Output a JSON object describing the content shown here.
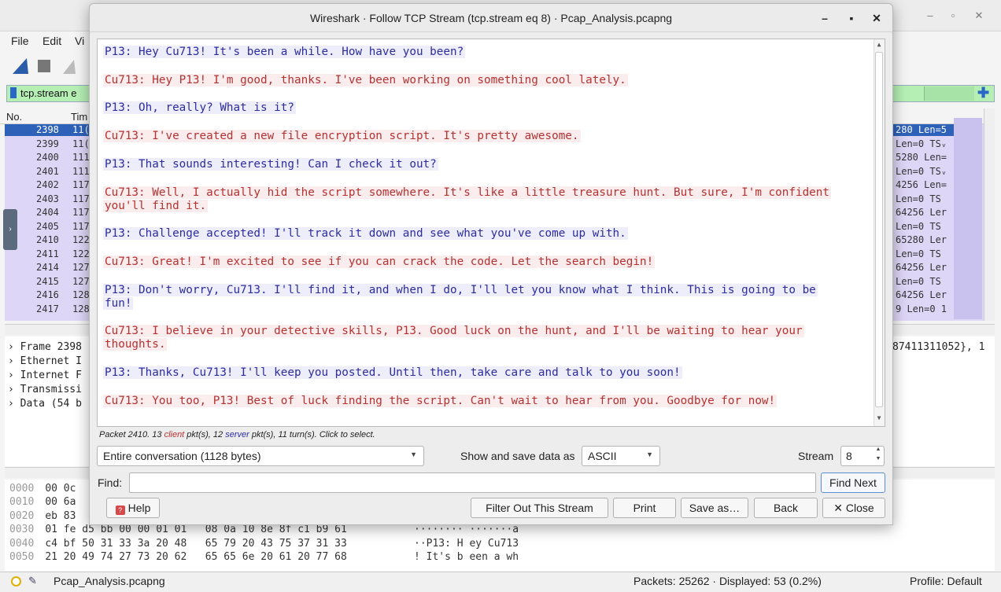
{
  "main_window": {
    "menu": [
      "File",
      "Edit",
      "Vi"
    ],
    "filter_text": "tcp.stream e",
    "columns": [
      "No.",
      "Tim"
    ],
    "packets": [
      {
        "no": "2398",
        "time": "11(",
        "info": "280 Len=5",
        "selected": true
      },
      {
        "no": "2399",
        "time": "11(",
        "info": "Len=0 TSᵥ"
      },
      {
        "no": "2400",
        "time": "111",
        "info": "5280 Len="
      },
      {
        "no": "2401",
        "time": "111",
        "info": "Len=0 TSᵥ"
      },
      {
        "no": "2402",
        "time": "117",
        "info": "4256 Len="
      },
      {
        "no": "2403",
        "time": "117",
        "info": "Len=0 TS"
      },
      {
        "no": "2404",
        "time": "117",
        "info": "64256 Ler"
      },
      {
        "no": "2405",
        "time": "117",
        "info": "Len=0 TS"
      },
      {
        "no": "2410",
        "time": "122",
        "info": "65280 Ler"
      },
      {
        "no": "2411",
        "time": "122",
        "info": "Len=0 TS"
      },
      {
        "no": "2414",
        "time": "127",
        "info": "64256 Ler"
      },
      {
        "no": "2415",
        "time": "127",
        "info": "Len=0 TS"
      },
      {
        "no": "2416",
        "time": "128",
        "info": "64256 Ler"
      },
      {
        "no": "2417",
        "time": "128",
        "info": "9 Len=0 1"
      }
    ],
    "details": [
      "› Frame 2398",
      "› Ethernet I",
      "› Internet F",
      "› Transmissi",
      "› Data (54 b"
    ],
    "details_right": "87411311052}, 1",
    "hex_rows": [
      {
        "off": "0000",
        "hex": "00 0c",
        "ascii": ""
      },
      {
        "off": "0010",
        "hex": "00 6a",
        "ascii": ""
      },
      {
        "off": "0020",
        "hex": "eb 83",
        "ascii": ""
      },
      {
        "off": "0030",
        "hex": "01 fe d5 bb 00 00 01 01   08 0a 10 8e 8f c1 b9 61",
        "ascii": "········ ·······a"
      },
      {
        "off": "0040",
        "hex": "c4 bf 50 31 33 3a 20 48   65 79 20 43 75 37 31 33",
        "ascii": "··P13: H ey Cu713"
      },
      {
        "off": "0050",
        "hex": "21 20 49 74 27 73 20 62   65 65 6e 20 61 20 77 68",
        "ascii": "! It's b een a wh"
      }
    ],
    "status": {
      "file": "Pcap_Analysis.pcapng",
      "packets": "Packets: 25262 · Displayed: 53 (0.2%)",
      "profile": "Profile: Default"
    }
  },
  "dialog": {
    "title": "Wireshark · Follow TCP Stream (tcp.stream eq 8) · Pcap_Analysis.pcapng",
    "messages": [
      {
        "role": "server",
        "text": "P13: Hey Cu713! It's been a while. How have you been?"
      },
      {
        "role": "client",
        "text": "Cu713: Hey P13! I'm good, thanks. I've been working on something cool lately."
      },
      {
        "role": "server",
        "text": "P13: Oh, really? What is it?"
      },
      {
        "role": "client",
        "text": "Cu713: I've created a new file encryption script. It's pretty awesome."
      },
      {
        "role": "server",
        "text": "P13: That sounds interesting! Can I check it out?"
      },
      {
        "role": "client",
        "text": "Cu713: Well, I actually hid the script somewhere. It's like a little treasure hunt. But sure, I'm confident\nyou'll find it."
      },
      {
        "role": "server",
        "text": "P13: Challenge accepted! I'll track it down and see what you've come up with."
      },
      {
        "role": "client",
        "text": "Cu713: Great! I'm excited to see if you can crack the code. Let the search begin!"
      },
      {
        "role": "server",
        "text": "P13: Don't worry, Cu713. I'll find it, and when I do, I'll let you know what I think. This is going to be\nfun!"
      },
      {
        "role": "client",
        "text": "Cu713: I believe in your detective skills, P13. Good luck on the hunt, and I'll be waiting to hear your\nthoughts."
      },
      {
        "role": "server",
        "text": "P13: Thanks, Cu713! I'll keep you posted. Until then, take care and talk to you soon!"
      },
      {
        "role": "client",
        "text": "Cu713: You too, P13! Best of luck finding the script. Can't wait to hear from you. Goodbye for now!"
      }
    ],
    "summary": {
      "prefix": "Packet 2410. 13 ",
      "client": "client",
      "mid1": " pkt(s), 12 ",
      "server": "server",
      "suffix": " pkt(s), 11 turn(s). Click to select."
    },
    "conversation_select": "Entire conversation (1128 bytes)",
    "show_as_label": "Show and save data as",
    "show_as_value": "ASCII",
    "stream_label": "Stream",
    "stream_value": "8",
    "find_label": "Find:",
    "find_value": "",
    "buttons": {
      "find_next": "Find Next",
      "help": "Help",
      "filter_out": "Filter Out This Stream",
      "print": "Print",
      "save_as": "Save as…",
      "back": "Back",
      "close": "Close"
    },
    "colors": {
      "client_bg": "#fbeded",
      "client_fg": "#b33232",
      "server_bg": "#ededfb",
      "server_fg": "#2d2d9e"
    }
  }
}
